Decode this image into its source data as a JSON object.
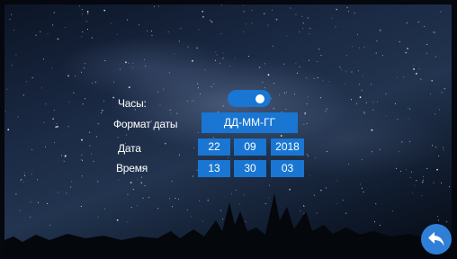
{
  "settings": {
    "clock_label": "Часы:",
    "clock_enabled": true,
    "date_format_label": "Формат даты",
    "date_format_value": "ДД-ММ-ГГ",
    "date_label": "Дата",
    "date": {
      "day": "22",
      "month": "09",
      "year": "2018"
    },
    "time_label": "Время",
    "time": {
      "hours": "13",
      "minutes": "30",
      "seconds": "03"
    }
  },
  "colors": {
    "accent": "#1976d2",
    "back_button": "#2f7fd6"
  },
  "icons": {
    "back": "back-arrow-icon"
  }
}
